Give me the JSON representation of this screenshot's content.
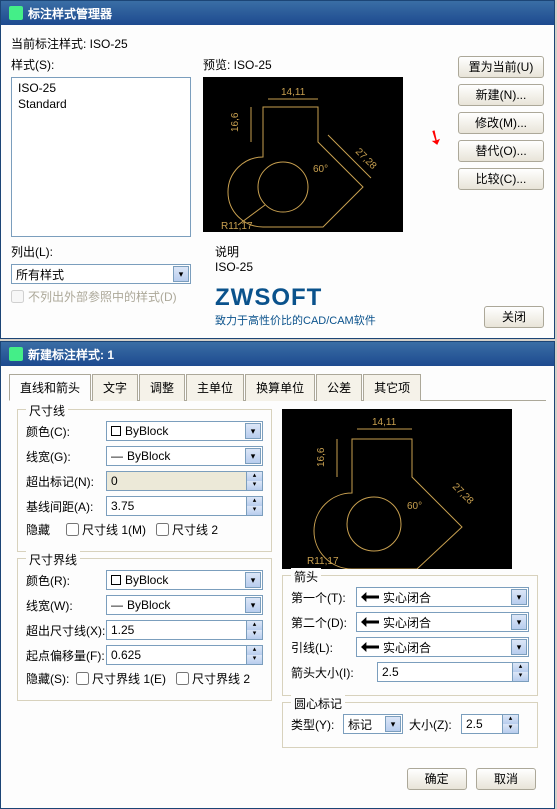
{
  "dlg1": {
    "title": "标注样式管理器",
    "current_label": "当前标注样式: ISO-25",
    "styles_label": "样式(S):",
    "styles": [
      "ISO-25",
      "Standard"
    ],
    "preview_label": "预览: ISO-25",
    "desc_label": "说明",
    "desc_value": "ISO-25",
    "list_label": "列出(L):",
    "list_value": "所有样式",
    "no_ext_ref": "不列出外部参照中的样式(D)",
    "buttons": {
      "set_current": "置为当前(U)",
      "new": "新建(N)...",
      "modify": "修改(M)...",
      "override": "替代(O)...",
      "compare": "比较(C)..."
    },
    "logo": "ZWSOFT",
    "logo_sub": "致力于高性价比的CAD/CAM软件",
    "close": "关闭"
  },
  "dlg2": {
    "title": "新建标注样式: 1",
    "tabs": [
      "直线和箭头",
      "文字",
      "调整",
      "主单位",
      "换算单位",
      "公差",
      "其它项"
    ],
    "dimline": {
      "title": "尺寸线",
      "color_label": "颜色(C):",
      "color_value": "ByBlock",
      "lw_label": "线宽(G):",
      "lw_value": "ByBlock",
      "ext_label": "超出标记(N):",
      "ext_value": "0",
      "baseline_label": "基线间距(A):",
      "baseline_value": "3.75",
      "hide_label": "隐藏",
      "hide1": "尺寸线 1(M)",
      "hide2": "尺寸线 2"
    },
    "extline": {
      "title": "尺寸界线",
      "color_label": "颜色(R):",
      "color_value": "ByBlock",
      "lw_label": "线宽(W):",
      "lw_value": "ByBlock",
      "ext_label": "超出尺寸线(X):",
      "ext_value": "1.25",
      "offset_label": "起点偏移量(F):",
      "offset_value": "0.625",
      "hide_label": "隐藏(S):",
      "hide1": "尺寸界线 1(E)",
      "hide2": "尺寸界线 2"
    },
    "arrow": {
      "title": "箭头",
      "first_label": "第一个(T):",
      "first_value": "实心闭合",
      "second_label": "第二个(D):",
      "second_value": "实心闭合",
      "leader_label": "引线(L):",
      "leader_value": "实心闭合",
      "size_label": "箭头大小(I):",
      "size_value": "2.5"
    },
    "center": {
      "title": "圆心标记",
      "type_label": "类型(Y):",
      "type_value": "标记",
      "size_label": "大小(Z):",
      "size_value": "2.5"
    },
    "ok": "确定",
    "cancel": "取消"
  },
  "preview_dims": {
    "top": "14,11",
    "left": "16,6",
    "diag": "27,28",
    "angle": "60°",
    "rad": "R11,17"
  }
}
